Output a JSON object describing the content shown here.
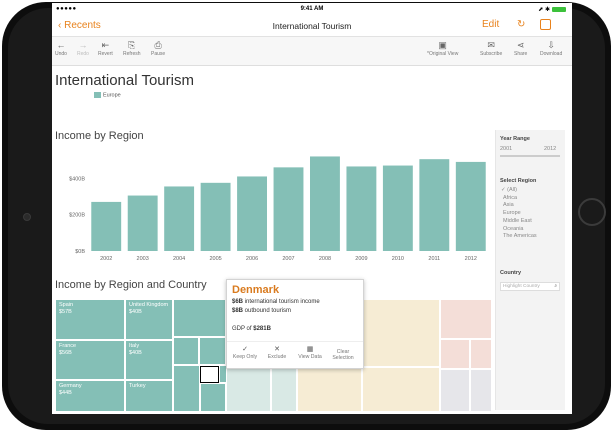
{
  "status": {
    "signal": "●●●●● ",
    "time": "9:41 AM",
    "right": "⬈ ✱"
  },
  "nav": {
    "back": "Recents",
    "title": "International Tourism",
    "edit": "Edit",
    "refresh_glyph": "↻"
  },
  "toolbar": {
    "undo": "Undo",
    "redo": "Redo",
    "revert": "Revert",
    "refresh": "Refresh",
    "pause": "Pause",
    "original": "*Original View",
    "subscribe": "Subscribe",
    "share": "Share",
    "download": "Download"
  },
  "page": {
    "title": "International Tourism",
    "legend": "Europe",
    "sub1": "Income by Region",
    "sub2": "Income by Region and Country"
  },
  "chart_data": {
    "type": "bar",
    "categories": [
      "2002",
      "2003",
      "2004",
      "2005",
      "2006",
      "2007",
      "2008",
      "2009",
      "2010",
      "2011",
      "2012"
    ],
    "values": [
      270,
      305,
      355,
      375,
      410,
      460,
      520,
      465,
      470,
      505,
      490
    ],
    "yticks": [
      "$0B",
      "$200B",
      "$400B"
    ],
    "ytick_values": [
      0,
      200,
      400
    ],
    "ylim": [
      0,
      550
    ],
    "color": "#84bfb6"
  },
  "panel": {
    "year_title": "Year Range",
    "year_from": "2001",
    "year_to": "2012",
    "region_title": "Select Region",
    "regions": [
      "✓ (All)",
      "Africa",
      "Asia",
      "Europe",
      "Middle East",
      "Oceania",
      "The Americas"
    ],
    "country_title": "Country",
    "country_placeholder": "Highlight Country"
  },
  "treemap": {
    "spain": "Spain",
    "spain_v": "$57B",
    "uk": "United Kingdom",
    "uk_v": "$40B",
    "france": "France",
    "france_v": "$56B",
    "italy": "Italy",
    "italy_v": "$40B",
    "germany": "Germany",
    "germany_v": "$44B",
    "turkey": "Turkey"
  },
  "tooltip": {
    "country": "Denmark",
    "line1_val": "$6B",
    "line1_txt": " international tourism income",
    "line2_val": "$8B",
    "line2_txt": " outbound tourism",
    "gdp_txt": "GDP of ",
    "gdp_val": "$281B",
    "keep": "Keep Only",
    "exclude": "Exclude",
    "view": "View Data",
    "clear": "Clear Selection",
    "keep_icon": "✓",
    "exclude_icon": "✕",
    "view_icon": "▦"
  }
}
